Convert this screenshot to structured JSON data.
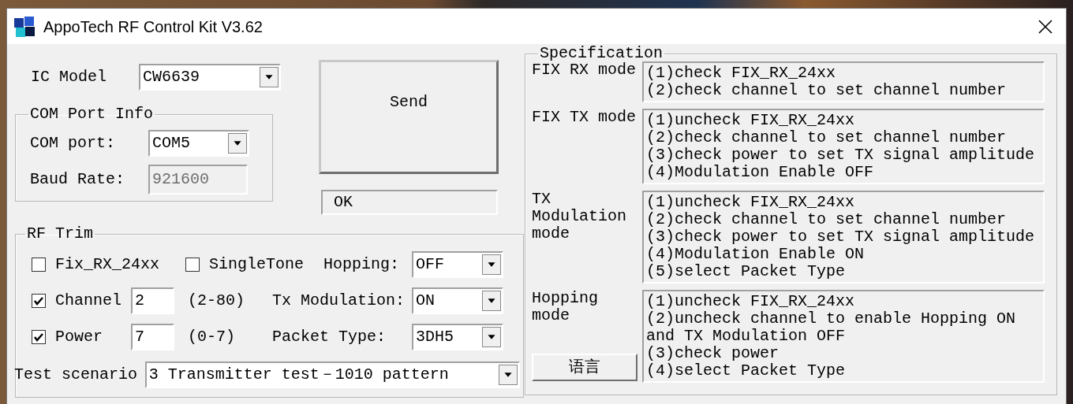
{
  "window": {
    "title": "AppoTech RF Control Kit V3.62"
  },
  "ic_model": {
    "label": "IC Model",
    "value": "CW6639"
  },
  "com_port_info": {
    "title": "COM Port Info",
    "com_port": {
      "label": "COM port:",
      "value": "COM5"
    },
    "baud_rate": {
      "label": "Baud Rate:",
      "value": "921600",
      "disabled": true
    }
  },
  "send_button": "Send",
  "status": "OK",
  "rf_trim": {
    "title": "RF Trim",
    "fix_rx": {
      "label": "Fix_RX_24xx",
      "checked": false
    },
    "single_tone": {
      "label": "SingleTone",
      "checked": false
    },
    "hopping": {
      "label": "Hopping:",
      "value": "OFF"
    },
    "channel": {
      "label": "Channel",
      "checked": true,
      "value": "2",
      "range": "(2-80)"
    },
    "tx_modulation": {
      "label": "Tx Modulation:",
      "value": "ON"
    },
    "power": {
      "label": "Power",
      "checked": true,
      "value": "7",
      "range": "(0-7)"
    },
    "packet_type": {
      "label": "Packet Type:",
      "value": "3DH5"
    }
  },
  "test_scenario": {
    "label": "Test scenario",
    "value": "3 Transmitter test－1010 pattern"
  },
  "specification": {
    "title": "Specification",
    "modes": [
      {
        "label": "FIX RX mode",
        "lines": [
          "(1)check FIX_RX_24xx",
          "(2)check channel to set channel number"
        ]
      },
      {
        "label": "FIX TX mode",
        "lines": [
          "(1)uncheck FIX_RX_24xx",
          "(2)check channel to set channel number",
          "(3)check power to set TX signal amplitude",
          "(4)Modulation Enable OFF"
        ]
      },
      {
        "label": "TX Modulation mode",
        "lines": [
          "(1)uncheck FIX_RX_24xx",
          "(2)check channel to set channel number",
          "(3)check power to set TX signal amplitude",
          "(4)Modulation Enable ON",
          "(5)select Packet Type"
        ]
      },
      {
        "label": "Hopping mode",
        "lines": [
          "(1)uncheck FIX_RX_24xx",
          "(2)uncheck channel to enable Hopping ON",
          "and TX Modulation OFF",
          "(3)check power",
          "(4)select Packet Type"
        ]
      }
    ]
  },
  "language_button": "语言"
}
